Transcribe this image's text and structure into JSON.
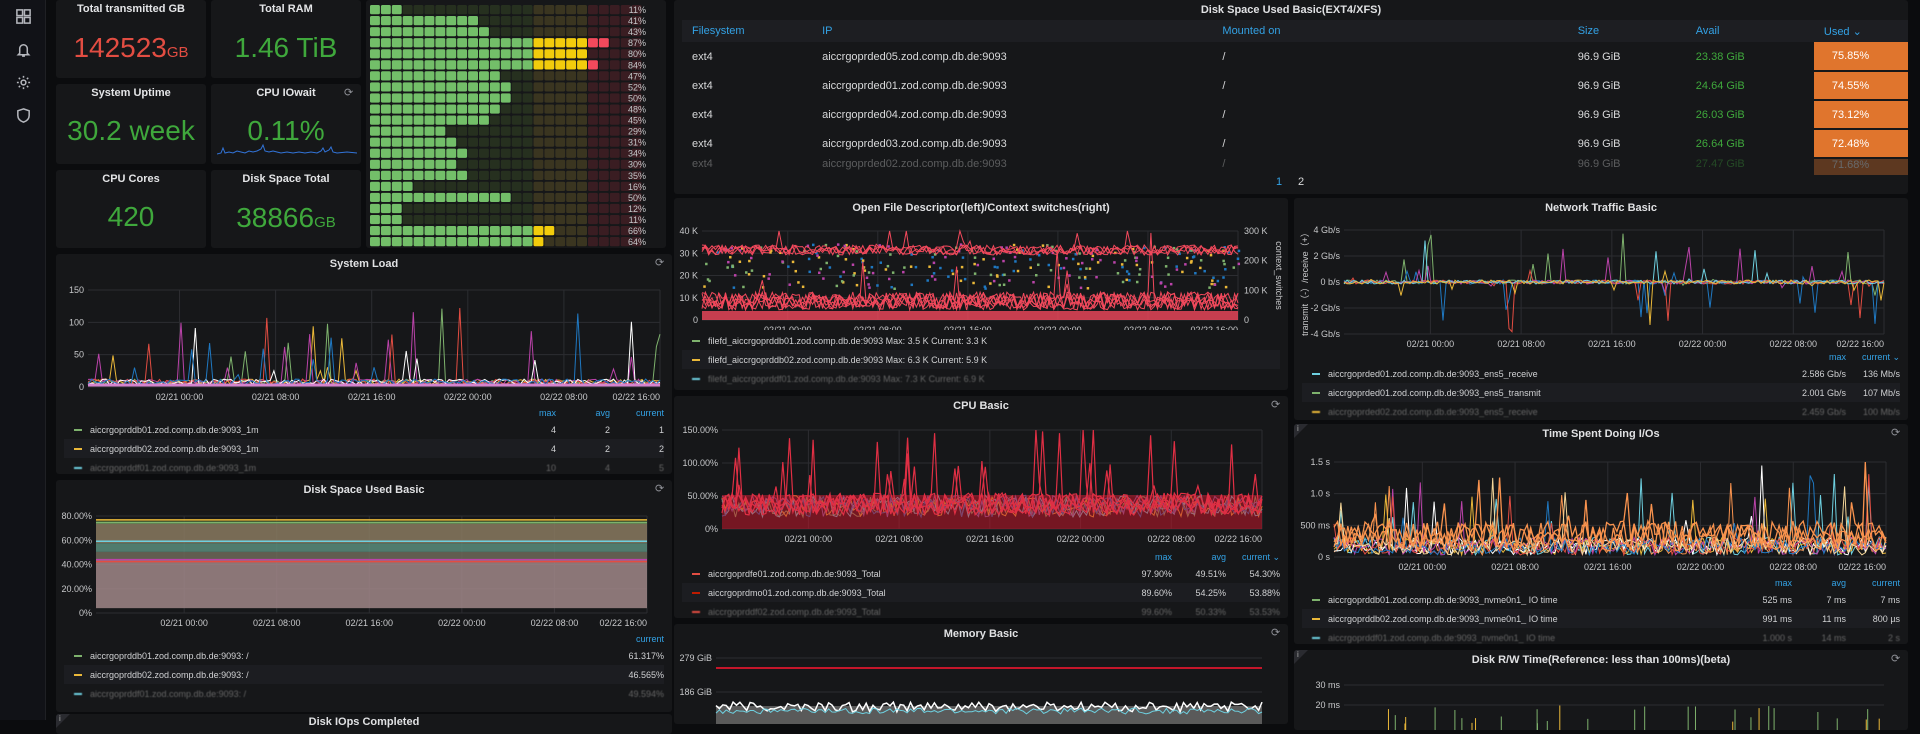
{
  "sidebar": {
    "items": [
      {
        "icon": "dashboards-icon"
      },
      {
        "icon": "bell-icon"
      },
      {
        "icon": "gear-icon"
      },
      {
        "icon": "shield-icon"
      }
    ]
  },
  "stats": {
    "total_transmitted": {
      "title": "Total transmitted GB",
      "value": "142523",
      "unit": "GB",
      "color": "#e24d42"
    },
    "total_ram": {
      "title": "Total RAM",
      "value": "1.46 TiB",
      "color": "#3fa83c"
    },
    "uptime": {
      "title": "System Uptime",
      "value": "30.2 week",
      "color": "#3fa83c"
    },
    "iowait": {
      "title": "CPU IOwait",
      "value": "0.11%",
      "color": "#3fa83c"
    },
    "cpu_cores": {
      "title": "CPU Cores",
      "value": "420",
      "color": "#3fa83c"
    },
    "disk_total": {
      "title": "Disk Space Total",
      "value": "38866",
      "unit": "GB",
      "color": "#3fa83c"
    }
  },
  "bargauge": {
    "values": [
      11,
      41,
      43,
      87,
      80,
      84,
      47,
      52,
      50,
      48,
      45,
      29,
      31,
      34,
      30,
      35,
      16,
      50,
      12,
      11,
      66,
      64
    ],
    "labels": [
      "11%",
      "41%",
      "43%",
      "87%",
      "80%",
      "84%",
      "47%",
      "52%",
      "50%",
      "48%",
      "45%",
      "29%",
      "31%",
      "34%",
      "30%",
      "35%",
      "16%",
      "50%",
      "12%",
      "11%",
      "66%",
      "64%"
    ],
    "thresholds": {
      "warn": 60,
      "crit": 80
    },
    "colors": {
      "ok": "#73bf69",
      "warn": "#f2cc0c",
      "crit": "#f2495c"
    }
  },
  "disk_table": {
    "title": "Disk Space Used Basic(EXT4/XFS)",
    "columns": [
      "Filesystem",
      "IP",
      "Mounted on",
      "Size",
      "Avail",
      "Used ⌄"
    ],
    "rows": [
      [
        "ext4",
        "aiccrgoprded05.zod.comp.db.de:9093",
        "/",
        "96.9 GiB",
        "23.38 GiB",
        "75.85%"
      ],
      [
        "ext4",
        "aiccrgoprded01.zod.comp.db.de:9093",
        "/",
        "96.9 GiB",
        "24.64 GiB",
        "74.55%"
      ],
      [
        "ext4",
        "aiccrgoprded04.zod.comp.db.de:9093",
        "/",
        "96.9 GiB",
        "26.03 GiB",
        "73.12%"
      ],
      [
        "ext4",
        "aiccrgoprded03.zod.comp.db.de:9093",
        "/",
        "96.9 GiB",
        "26.64 GiB",
        "72.48%"
      ],
      [
        "ext4",
        "aiccrgoprded02.zod.comp.db.de:9093",
        "/",
        "96.9 GiB",
        "27.47 GiB",
        "71.68%"
      ]
    ],
    "pages": [
      "1",
      "2"
    ],
    "current_page": "1"
  },
  "x_ticks": [
    "02/21 00:00",
    "02/21 08:00",
    "02/21 16:00",
    "02/22 00:00",
    "02/22 08:00",
    "02/22 16:00"
  ],
  "panels": {
    "system_load": {
      "title": "System Load",
      "y_ticks": [
        "150",
        "100",
        "50",
        "0"
      ],
      "legend_head": [
        "max",
        "avg",
        "current"
      ],
      "legend": [
        {
          "name": "aiccrgoprddb01.zod.comp.db.de:9093_1m",
          "color": "#7eb26d",
          "vals": [
            "4",
            "2",
            "1"
          ]
        },
        {
          "name": "aiccrgoprddb02.zod.comp.db.de:9093_1m",
          "color": "#eab839",
          "vals": [
            "4",
            "2",
            "2"
          ]
        },
        {
          "name": "aiccrgoprddf01.zod.comp.db.de:9093_1m",
          "color": "#6ed0e0",
          "vals": [
            "10",
            "4",
            "5"
          ]
        }
      ]
    },
    "disk_used_basic": {
      "title": "Disk Space Used Basic",
      "y_ticks": [
        "80.00%",
        "60.00%",
        "40.00%",
        "20.00%",
        "0%"
      ],
      "legend_head": [
        "current"
      ],
      "legend": [
        {
          "name": "aiccrgoprddb01.zod.comp.db.de:9093:  /",
          "color": "#7eb26d",
          "vals": [
            "61.317%"
          ]
        },
        {
          "name": "aiccrgoprddb02.zod.comp.db.de:9093:  /",
          "color": "#eab839",
          "vals": [
            "46.565%"
          ]
        },
        {
          "name": "aiccrgoprddf01.zod.comp.db.de:9093:  /",
          "color": "#6ed0e0",
          "vals": [
            "49.594%"
          ]
        }
      ]
    },
    "disk_iops": {
      "title": "Disk IOps Completed"
    },
    "open_fd": {
      "title": "Open File Descriptor(left)/Context switches(right)",
      "y_ticks": [
        "40 K",
        "30 K",
        "20 K",
        "10 K",
        "0"
      ],
      "y2_ticks": [
        "300 K",
        "200 K",
        "100 K",
        "0"
      ],
      "y2_label": "context_switches",
      "legend": [
        {
          "name": "filefd_aiccrgoprddb01.zod.comp.db.de:9093  Max: 3.5 K  Current: 3.3 K",
          "color": "#7eb26d"
        },
        {
          "name": "filefd_aiccrgoprddb02.zod.comp.db.de:9093  Max: 6.3 K  Current: 5.9 K",
          "color": "#eab839"
        },
        {
          "name": "filefd_aiccrgoprddf01.zod.comp.db.de:9093  Max: 7.3 K  Current: 6.9 K",
          "color": "#6ed0e0"
        }
      ]
    },
    "cpu_basic": {
      "title": "CPU Basic",
      "y_ticks": [
        "150.00%",
        "100.00%",
        "50.00%",
        "0%"
      ],
      "legend_head": [
        "max",
        "avg",
        "current ⌄"
      ],
      "legend": [
        {
          "name": "aiccrgoprdfe01.zod.comp.db.de:9093_Total",
          "color": "#e24d42",
          "vals": [
            "97.90%",
            "49.51%",
            "54.30%"
          ]
        },
        {
          "name": "aiccrgoprdmo01.zod.comp.db.de:9093_Total",
          "color": "#bf1b00",
          "vals": [
            "89.60%",
            "54.25%",
            "53.88%"
          ]
        },
        {
          "name": "aiccrgoprddf02.zod.comp.db.de:9093_Total",
          "color": "#e24d42",
          "vals": [
            "99.60%",
            "50.33%",
            "53.53%"
          ]
        }
      ]
    },
    "memory_basic": {
      "title": "Memory Basic",
      "y_ticks": [
        "279 GiB",
        "186 GiB"
      ]
    },
    "network": {
      "title": "Network Traffic Basic",
      "y_ticks": [
        "4 Gb/s",
        "2 Gb/s",
        "0 b/s",
        "-2 Gb/s",
        "-4 Gb/s"
      ],
      "y_label": "transmit（-）/receive（+）",
      "legend_head": [
        "max",
        "current ⌄"
      ],
      "legend": [
        {
          "name": "aiccrgoprded01.zod.comp.db.de:9093_ens5_receive",
          "color": "#6ed0e0",
          "vals": [
            "2.586 Gb/s",
            "136 Mb/s"
          ]
        },
        {
          "name": "aiccrgoprded01.zod.comp.db.de:9093_ens5_transmit",
          "color": "#7eb26d",
          "vals": [
            "2.001 Gb/s",
            "107 Mb/s"
          ]
        },
        {
          "name": "aiccrgoprded02.zod.comp.db.de:9093_ens5_receive",
          "color": "#eab839",
          "vals": [
            "2.459 Gb/s",
            "100 Mb/s"
          ]
        }
      ]
    },
    "io_time": {
      "title": "Time Spent Doing I/Os",
      "y_ticks": [
        "1.5 s",
        "1.0 s",
        "500 ms",
        "0 s"
      ],
      "legend_head": [
        "max",
        "avg",
        "current"
      ],
      "legend": [
        {
          "name": "aiccrgoprddb01.zod.comp.db.de:9093_nvme0n1_ IO time",
          "color": "#7eb26d",
          "vals": [
            "525 ms",
            "7 ms",
            "7 ms"
          ]
        },
        {
          "name": "aiccrgoprddb02.zod.comp.db.de:9093_nvme0n1_ IO time",
          "color": "#eab839",
          "vals": [
            "991 ms",
            "11 ms",
            "800 µs"
          ]
        },
        {
          "name": "aiccrgoprddf01.zod.comp.db.de:9093_nvme0n1_ IO time",
          "color": "#6ed0e0",
          "vals": [
            "1.000 s",
            "14 ms",
            "2 s"
          ]
        }
      ]
    },
    "disk_rw": {
      "title": "Disk R/W Time(Reference: less than 100ms)(beta)",
      "y_ticks": [
        "30 ms",
        "20 ms"
      ]
    }
  }
}
